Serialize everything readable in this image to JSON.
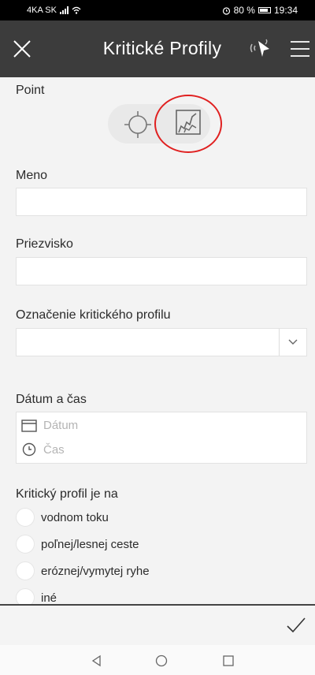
{
  "status_bar": {
    "carrier": "4KA SK",
    "battery": "80 %",
    "time": "19:34",
    "icons": [
      "signal-icon",
      "wifi-icon",
      "alarm-icon",
      "battery-icon"
    ]
  },
  "app_bar": {
    "title": "Kritické Profily",
    "icons": [
      "close-icon",
      "gps-icon",
      "menu-icon"
    ]
  },
  "form": {
    "point_label": "Point",
    "point_toggle": {
      "options": [
        "crosshair-icon",
        "map-sketch-icon"
      ],
      "selected": "map-sketch-icon"
    },
    "meno_label": "Meno",
    "meno_value": "",
    "priezvisko_label": "Priezvisko",
    "priezvisko_value": "",
    "oznacenie_label": "Označenie kritického profilu",
    "oznacenie_value": "",
    "datum_cas_label": "Dátum a čas",
    "datum_placeholder": "Dátum",
    "cas_placeholder": "Čas",
    "profil_label": "Kritický profil je na",
    "profil_options": [
      "vodnom toku",
      "poľnej/lesnej ceste",
      "eróznej/vymytej ryhe",
      "iné"
    ]
  },
  "colors": {
    "app_bar": "#3c3c3c",
    "background": "#f3f3f3",
    "highlight_circle": "#e02020"
  }
}
